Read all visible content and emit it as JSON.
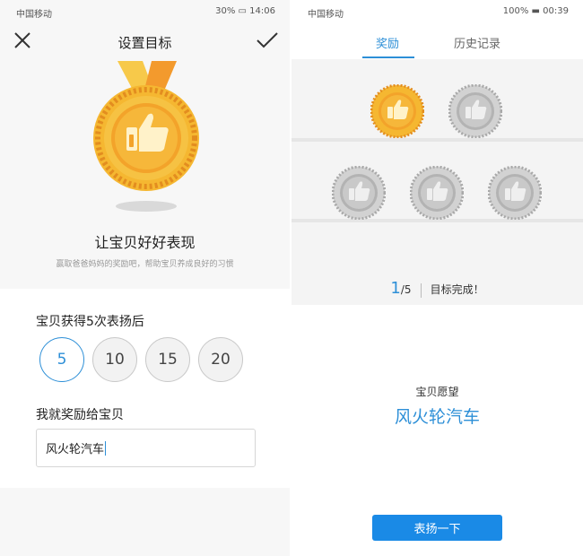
{
  "left": {
    "status": {
      "carrier": "中国移动",
      "battery": "30%",
      "time": "14:06"
    },
    "nav": {
      "title": "设置目标",
      "close_icon": "close-icon",
      "confirm_icon": "check-icon"
    },
    "medal": {
      "icon": "thumbs-up-medal"
    },
    "slogan": "让宝贝好好表现",
    "subtitle": "赢取爸爸妈妈的奖励吧，帮助宝贝养成良好的习惯",
    "praise_question": "宝贝获得5次表扬后",
    "praise_options": [
      "5",
      "10",
      "15",
      "20"
    ],
    "selected_option": "5",
    "reward_question": "我就奖励给宝贝",
    "reward_value": "风火轮汽车"
  },
  "right": {
    "status": {
      "carrier": "中国移动",
      "battery": "100%",
      "time": "00:39"
    },
    "tabs": [
      {
        "label": "奖励",
        "active": true
      },
      {
        "label": "历史记录",
        "active": false
      }
    ],
    "medals": {
      "earned": 1,
      "total": 5
    },
    "progress": {
      "current": "1",
      "total": "/5",
      "text": "目标完成！"
    },
    "wish_label": "宝贝愿望",
    "wish_value": "风火轮汽车",
    "praise_button": "表扬一下"
  },
  "colors": {
    "accent": "#2d8fd7",
    "button": "#1a8ae6",
    "gold": "#f5a623",
    "silver": "#bdbdbd"
  }
}
